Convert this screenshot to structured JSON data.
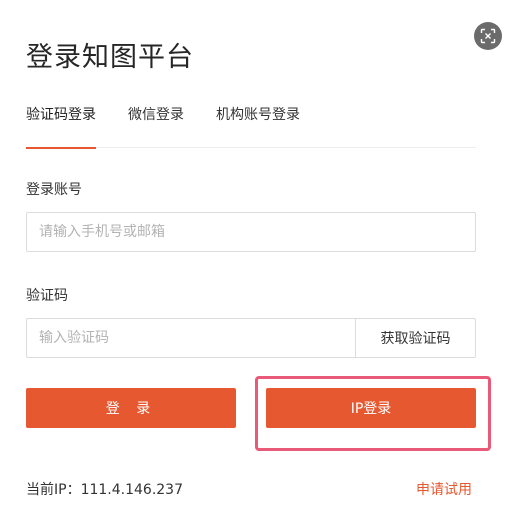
{
  "title": "登录知图平台",
  "tabs": [
    {
      "label": "验证码登录",
      "active": true
    },
    {
      "label": "微信登录",
      "active": false
    },
    {
      "label": "机构账号登录",
      "active": false
    }
  ],
  "account": {
    "label": "登录账号",
    "placeholder": "请输入手机号或邮箱"
  },
  "code": {
    "label": "验证码",
    "placeholder": "输入验证码",
    "get_code_label": "获取验证码"
  },
  "buttons": {
    "login_label": "登 录",
    "ip_login_label": "IP登录"
  },
  "footer": {
    "ip_text": "当前IP：111.4.146.237",
    "apply_label": "申请试用"
  },
  "colors": {
    "accent": "#e6582f",
    "highlight": "#e85a78",
    "close_bg": "#6b6b6b"
  },
  "icons": {
    "close": "scan-close-icon"
  }
}
